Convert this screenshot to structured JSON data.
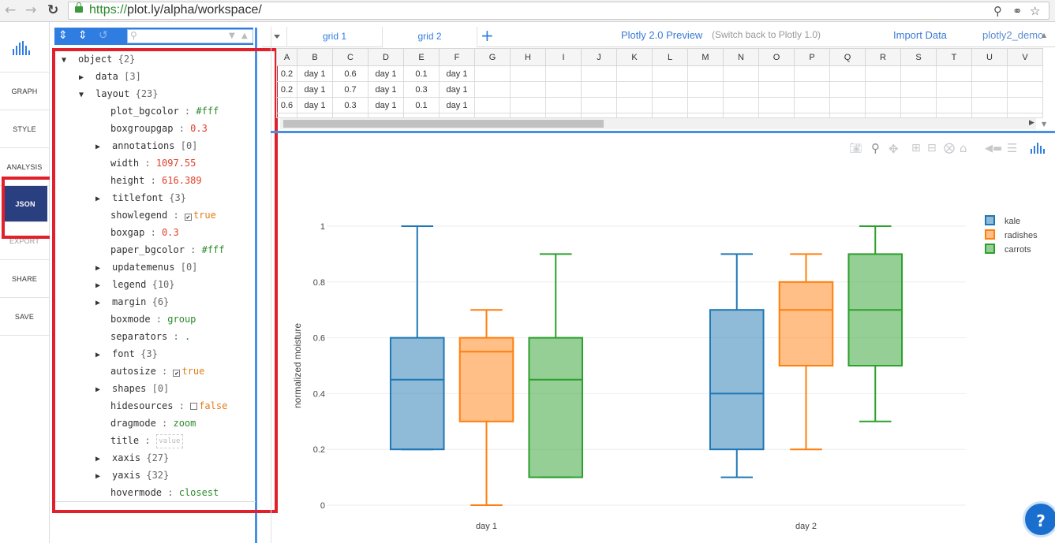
{
  "browser": {
    "url_scheme": "https://",
    "url_rest": "plot.ly/alpha/workspace/"
  },
  "leftnav": {
    "items": [
      {
        "label": "GRAPH",
        "state": "normal"
      },
      {
        "label": "STYLE",
        "state": "normal"
      },
      {
        "label": "ANALYSIS",
        "state": "normal"
      },
      {
        "label": "JSON",
        "state": "active"
      },
      {
        "label": "EXPORT",
        "state": "muted"
      },
      {
        "label": "SHARE",
        "state": "normal"
      },
      {
        "label": "SAVE",
        "state": "normal"
      }
    ]
  },
  "json_tree": {
    "root": {
      "key": "object",
      "count": "{2}"
    },
    "data": {
      "key": "data",
      "count": "[3]"
    },
    "layout": {
      "key": "layout",
      "count": "{23}"
    },
    "props": [
      {
        "key": "plot_bgcolor",
        "type": "str",
        "value": "#fff"
      },
      {
        "key": "boxgroupgap",
        "type": "num",
        "value": "0.3"
      },
      {
        "key": "annotations",
        "type": "node",
        "count": "[0]"
      },
      {
        "key": "width",
        "type": "num",
        "value": "1097.55"
      },
      {
        "key": "height",
        "type": "num",
        "value": "616.389"
      },
      {
        "key": "titlefont",
        "type": "node",
        "count": "{3}"
      },
      {
        "key": "showlegend",
        "type": "bool",
        "checked": true,
        "value": "true"
      },
      {
        "key": "boxgap",
        "type": "num",
        "value": "0.3"
      },
      {
        "key": "paper_bgcolor",
        "type": "str",
        "value": "#fff"
      },
      {
        "key": "updatemenus",
        "type": "node",
        "count": "[0]"
      },
      {
        "key": "legend",
        "type": "node",
        "count": "{10}"
      },
      {
        "key": "margin",
        "type": "node",
        "count": "{6}"
      },
      {
        "key": "boxmode",
        "type": "str",
        "value": "group"
      },
      {
        "key": "separators",
        "type": "str",
        "value": "."
      },
      {
        "key": "font",
        "type": "node",
        "count": "{3}"
      },
      {
        "key": "autosize",
        "type": "bool",
        "checked": true,
        "value": "true"
      },
      {
        "key": "shapes",
        "type": "node",
        "count": "[0]"
      },
      {
        "key": "hidesources",
        "type": "bool",
        "checked": false,
        "value": "false"
      },
      {
        "key": "dragmode",
        "type": "str",
        "value": "zoom"
      },
      {
        "key": "title",
        "type": "empty",
        "value": "value"
      },
      {
        "key": "xaxis",
        "type": "node",
        "count": "{27}"
      },
      {
        "key": "yaxis",
        "type": "node",
        "count": "{32}"
      },
      {
        "key": "hovermode",
        "type": "str",
        "value": "closest"
      }
    ]
  },
  "tabs": {
    "items": [
      "grid 1",
      "grid 2"
    ],
    "preview_link": "Plotly 2.0 Preview",
    "switch_back": "(Switch back to Plotly 1.0)",
    "import_link": "Import Data",
    "user": "plotly2_demo"
  },
  "sheet": {
    "columns": [
      "A",
      "B",
      "C",
      "D",
      "E",
      "F",
      "G",
      "H",
      "I",
      "J",
      "K",
      "L",
      "M",
      "N",
      "O",
      "P",
      "Q",
      "R",
      "S",
      "T",
      "U",
      "V"
    ],
    "rows": [
      [
        "0.2",
        "day 1",
        "0.6",
        "day 1",
        "0.1",
        "day 1"
      ],
      [
        "0.2",
        "day 1",
        "0.7",
        "day 1",
        "0.3",
        "day 1"
      ],
      [
        "0.6",
        "day 1",
        "0.3",
        "day 1",
        "0.1",
        "day 1"
      ]
    ]
  },
  "chart_data": {
    "type": "box",
    "categories": [
      "day 1",
      "day 2"
    ],
    "ylabel": "normalized moisture",
    "ylim": [
      0,
      1
    ],
    "yticks": [
      "0",
      "0.2",
      "0.4",
      "0.6",
      "0.8",
      "1"
    ],
    "grid": true,
    "legend_position": "top-right",
    "series": [
      {
        "name": "kale",
        "color": "#1f77b4",
        "boxes": [
          {
            "min": 0.2,
            "q1": 0.2,
            "median": 0.45,
            "q3": 0.6,
            "max": 1.0
          },
          {
            "min": 0.1,
            "q1": 0.2,
            "median": 0.4,
            "q3": 0.7,
            "max": 0.9
          }
        ]
      },
      {
        "name": "radishes",
        "color": "#ff7f0e",
        "boxes": [
          {
            "min": 0.0,
            "q1": 0.3,
            "median": 0.55,
            "q3": 0.6,
            "max": 0.7
          },
          {
            "min": 0.2,
            "q1": 0.5,
            "median": 0.7,
            "q3": 0.8,
            "max": 0.9
          }
        ]
      },
      {
        "name": "carrots",
        "color": "#2ca02c",
        "boxes": [
          {
            "min": 0.1,
            "q1": 0.1,
            "median": 0.45,
            "q3": 0.6,
            "max": 0.9
          },
          {
            "min": 0.3,
            "q1": 0.5,
            "median": 0.7,
            "q3": 0.9,
            "max": 1.0
          }
        ]
      }
    ]
  }
}
